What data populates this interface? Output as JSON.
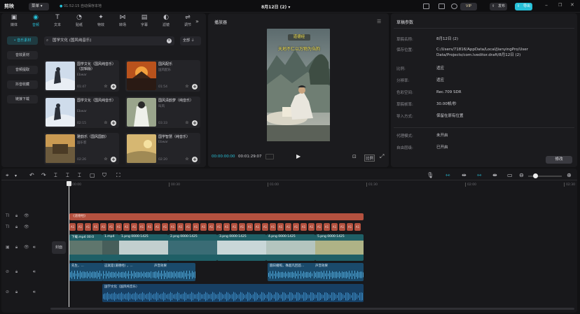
{
  "titlebar": {
    "app_name": "剪映",
    "menu_label": "菜单",
    "autosave": "01:52:15 自动保存本地",
    "project_title": "8月12日 (2)",
    "vip_label": "VIP",
    "share_label": "发布",
    "export_label": "导出"
  },
  "media": {
    "categories": [
      {
        "label": "媒体",
        "icon": "media-icon"
      },
      {
        "label": "音频",
        "icon": "audio-icon"
      },
      {
        "label": "文本",
        "icon": "text-icon"
      },
      {
        "label": "贴纸",
        "icon": "sticker-icon"
      },
      {
        "label": "特效",
        "icon": "effects-icon"
      },
      {
        "label": "转场",
        "icon": "transition-icon"
      },
      {
        "label": "字幕",
        "icon": "caption-icon"
      },
      {
        "label": "滤镜",
        "icon": "filter-icon"
      },
      {
        "label": "调节",
        "icon": "adjust-icon"
      }
    ],
    "sidebar": [
      "• 音乐素材",
      "音效素材",
      "音频提取",
      "抖音收藏",
      "链接下载"
    ],
    "search_value": "国学文化 (国风纯音乐)",
    "filter_label": "全部",
    "cards": [
      {
        "title": "国学文化（国风纯音乐）（剪辑版）",
        "author": "Ebwar",
        "duration": "01:47"
      },
      {
        "title": "国风配乐",
        "author": "国风配乐",
        "duration": "01:54"
      },
      {
        "title": "国学文化（国风纯音乐）",
        "author": "Ebwar",
        "duration": "02:15"
      },
      {
        "title": "国风清韵梦（纯音乐）",
        "author": "叫风",
        "duration": "03:33"
      },
      {
        "title": "雅韵乐（国风国韵）",
        "author": "国乐客",
        "duration": "02:26"
      },
      {
        "title": "国学智慧（纯音乐）",
        "author": "Ebwar",
        "duration": "02:20"
      }
    ]
  },
  "player": {
    "title": "播放器",
    "current_time": "00:00:00:00",
    "total_time": "00:01:29:07",
    "ratio_label": "比例",
    "caption_top": "道德经",
    "caption_main": "天地不仁以万物为刍狗"
  },
  "details": {
    "title": "草稿参数",
    "rows": [
      {
        "label": "草稿名称:",
        "value": "8月12日 (2)"
      },
      {
        "label": "保存位置:",
        "value": "C:/Users/71816/AppData/Local/JianyingPro/User Data/Projects/com.lveditor.draft/8月12日 (2)"
      },
      {
        "label": "比例:",
        "value": "适应"
      },
      {
        "label": "分辨率:",
        "value": "适应"
      },
      {
        "label": "色彩空间:",
        "value": "Rec.709 SDR"
      },
      {
        "label": "草稿帧率:",
        "value": "30.00帧/秒"
      },
      {
        "label": "导入方式:",
        "value": "保留在原有位置"
      },
      {
        "label": "代理模式:",
        "value": "未开启"
      },
      {
        "label": "自由层级:",
        "value": "已开启"
      }
    ],
    "edit_label": "修改"
  },
  "timeline": {
    "ruler": [
      "00:00",
      "00:30",
      "01:00",
      "01:30",
      "02:00",
      "02:30"
    ],
    "text_clip": "《道德经》",
    "sticker_label": "A1",
    "cover_label": "封面",
    "video_clips": [
      {
        "label": "下载.mp4  00:0",
        "color": "#1f5f66"
      },
      {
        "label": "1.mp4",
        "color": "#1f5f66"
      },
      {
        "label": "1.png  0000:1425",
        "color": "#1f5f66"
      },
      {
        "label": "2.png  0000:1425",
        "color": "#1f5f66"
      },
      {
        "label": "3.png  0000:1425",
        "color": "#1f5f66"
      },
      {
        "label": "4.png  0000:1425",
        "color": "#1f5f66"
      },
      {
        "label": "5.png  0000:1425",
        "color": "#1f5f66"
      }
    ],
    "audio_clips": [
      {
        "label": "先生，..."
      },
      {
        "label": "这就是(道德经) ，..."
      },
      {
        "label": "声音效果"
      },
      {
        "label": "圆日播照，殊超凡回首..."
      },
      {
        "label": "声音效果"
      }
    ],
    "music_clip": "国学文化（国风纯音乐）"
  },
  "colors": {
    "accent": "#27c0d8",
    "text_track": "#b4513f",
    "video_track": "#1f5f66",
    "audio_track": "#1a4a6b"
  }
}
